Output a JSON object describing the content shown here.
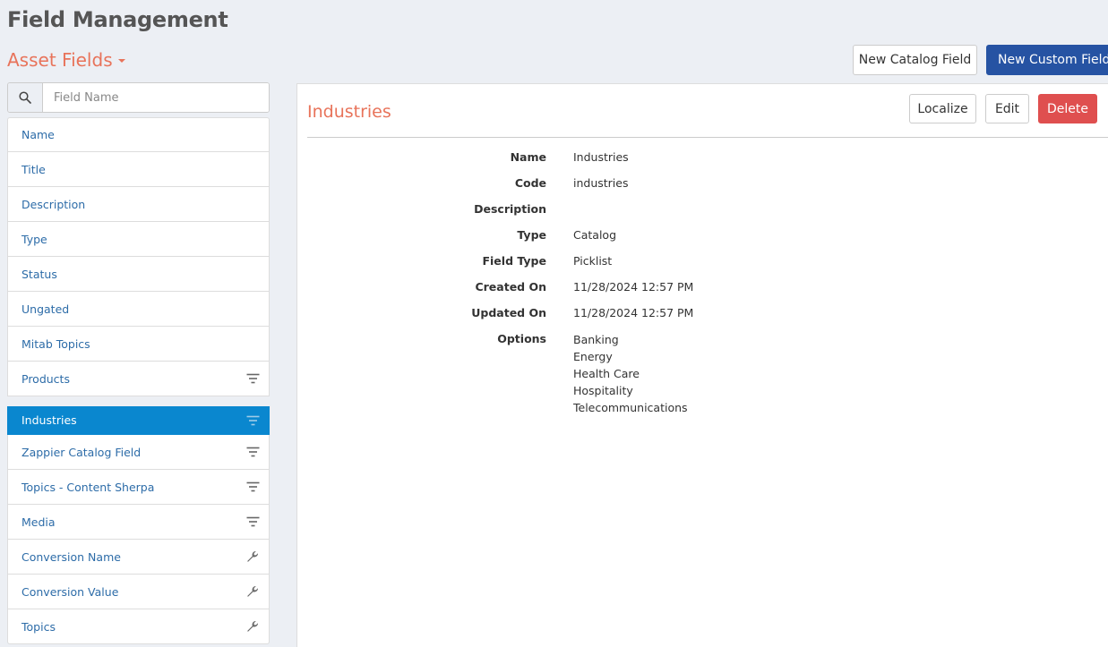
{
  "header": {
    "title": "Field Management",
    "section_selector": "Asset Fields"
  },
  "actions": {
    "new_catalog_field": "New Catalog Field",
    "new_custom_field": "New Custom Field"
  },
  "search": {
    "placeholder": "Field Name",
    "value": ""
  },
  "fields": [
    {
      "label": "Name",
      "icon": null
    },
    {
      "label": "Title",
      "icon": null
    },
    {
      "label": "Description",
      "icon": null
    },
    {
      "label": "Type",
      "icon": null
    },
    {
      "label": "Status",
      "icon": null
    },
    {
      "label": "Ungated",
      "icon": null
    },
    {
      "label": "Mitab Topics",
      "icon": null
    },
    {
      "label": "Products",
      "icon": "filter-icon"
    },
    {
      "label": "Industries",
      "icon": "filter-icon",
      "selected": true
    },
    {
      "label": "Zappier Catalog Field",
      "icon": "filter-icon"
    },
    {
      "label": "Topics - Content Sherpa",
      "icon": "filter-icon"
    },
    {
      "label": "Media",
      "icon": "filter-icon"
    },
    {
      "label": "Conversion Name",
      "icon": "wrench-icon"
    },
    {
      "label": "Conversion Value",
      "icon": "wrench-icon"
    },
    {
      "label": "Topics",
      "icon": "wrench-icon"
    }
  ],
  "detail": {
    "title": "Industries",
    "buttons": {
      "localize": "Localize",
      "edit": "Edit",
      "delete": "Delete"
    },
    "properties": {
      "name": {
        "label": "Name",
        "value": "Industries"
      },
      "code": {
        "label": "Code",
        "value": "industries"
      },
      "description": {
        "label": "Description",
        "value": ""
      },
      "type": {
        "label": "Type",
        "value": "Catalog"
      },
      "field_type": {
        "label": "Field Type",
        "value": "Picklist"
      },
      "created_on": {
        "label": "Created On",
        "value": "11/28/2024 12:57 PM"
      },
      "updated_on": {
        "label": "Updated On",
        "value": "11/28/2024 12:57 PM"
      },
      "options": {
        "label": "Options",
        "values": [
          "Banking",
          "Energy",
          "Health Care",
          "Hospitality",
          "Telecommunications"
        ]
      }
    }
  },
  "colors": {
    "accent": "#e8735a",
    "primary": "#2653a3",
    "danger": "#df4f4f",
    "selected": "#0a87cf",
    "link": "#2d6ca8"
  }
}
